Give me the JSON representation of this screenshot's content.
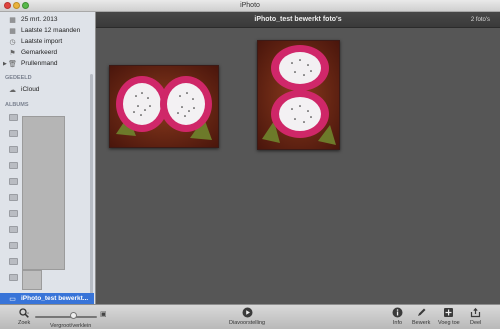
{
  "app": {
    "title": "iPhoto"
  },
  "sidebar": {
    "recent": [
      {
        "label": "25 mrt. 2013",
        "icon": "calendar-icon"
      },
      {
        "label": "Laatste 12 maanden",
        "icon": "calendar-icon"
      },
      {
        "label": "Laatste import",
        "icon": "clock-icon"
      },
      {
        "label": "Gemarkeerd",
        "icon": "flag-icon"
      },
      {
        "label": "Prullenmand",
        "icon": "trash-icon"
      }
    ],
    "shared_heading": "GEDEELD",
    "shared": [
      {
        "label": "iCloud",
        "icon": "cloud-icon"
      }
    ],
    "albums_heading": "ALBUMS",
    "selected_album": "iPhoto_test bewerkt..."
  },
  "main": {
    "title": "iPhoto_test bewerkt foto's",
    "count": "2 foto's"
  },
  "toolbar": {
    "zoom_label": "Zoek",
    "size_label": "Vergroot/verklein",
    "size_value": 0.62,
    "slideshow_label": "Diavoorstelling",
    "info_label": "Info",
    "edit_label": "Bewerk",
    "add_label": "Voeg toe",
    "share_label": "Deel"
  },
  "colors": {
    "selection": "#3874d8",
    "canvas": "#565656"
  }
}
